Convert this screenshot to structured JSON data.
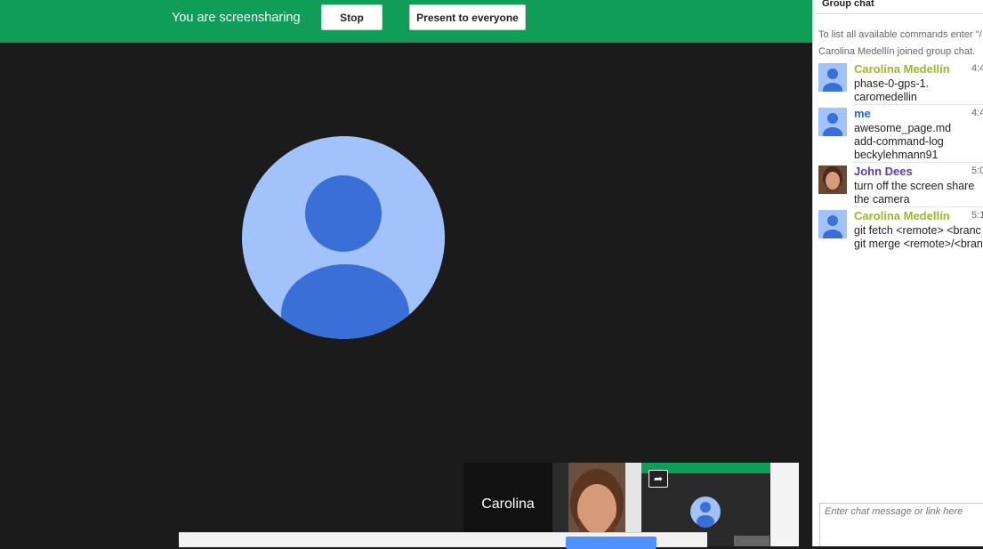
{
  "topbar": {
    "message": "You are screensharing",
    "stop_label": "Stop",
    "present_label": "Present to everyone"
  },
  "filmstrip": {
    "participant_name": "Carolina"
  },
  "chat": {
    "title": "Group chat",
    "system_help": "To list all available commands enter \"/",
    "system_joined": "Carolina Medellín joined group chat.",
    "messages": [
      {
        "author": "Carolina Medellín",
        "time": "4:4",
        "lines": [
          "phase-0-gps-1.",
          "caromedellin"
        ],
        "color": "#9bb82c"
      },
      {
        "author": "me",
        "time": "4:4",
        "lines": [
          "awesome_page.md",
          "add-command-log",
          "beckylehmann91"
        ],
        "color": "#1f6bd6"
      },
      {
        "author": "John Dees",
        "time": "5:0",
        "lines": [
          "turn off the screen share",
          "the camera"
        ],
        "color": "#5b3bb4"
      },
      {
        "author": "Carolina Medellín",
        "time": "5:1",
        "lines": [
          "git fetch <remote> <branc",
          "git merge <remote>/<bran"
        ],
        "color": "#9bb82c"
      }
    ],
    "input_placeholder": "Enter chat message or link here"
  },
  "icons": {
    "avatar": "default-user-avatar-icon",
    "share": "share-screen-icon"
  },
  "colors": {
    "topbar": "#0f9d58",
    "avatar_light": "#a1c2fa",
    "avatar_dark": "#3b6fd8"
  }
}
